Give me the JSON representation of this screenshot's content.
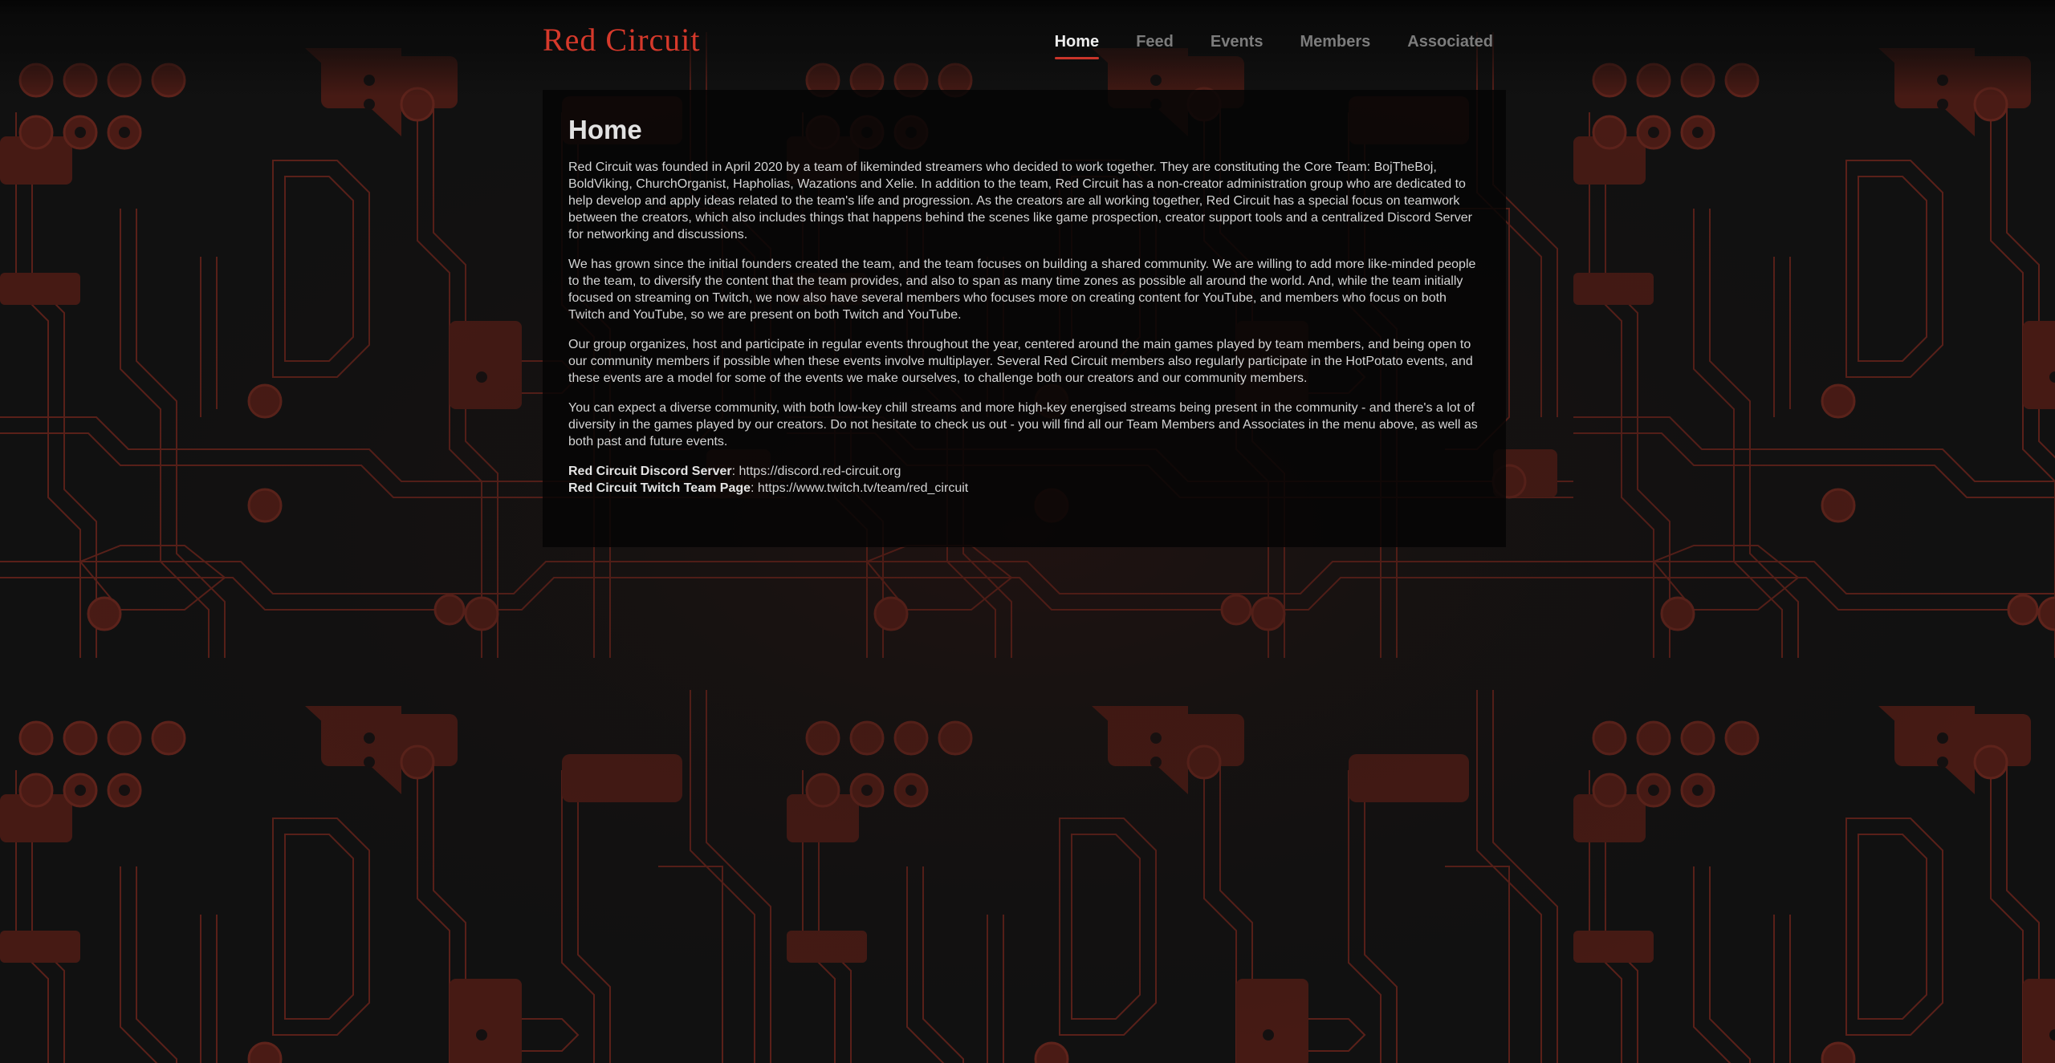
{
  "site": {
    "logo_text": "Red Circuit",
    "brand_color": "#d6392b",
    "accent_color": "#c9352a"
  },
  "nav": {
    "items": [
      {
        "label": "Home",
        "active": true
      },
      {
        "label": "Feed",
        "active": false
      },
      {
        "label": "Events",
        "active": false
      },
      {
        "label": "Members",
        "active": false
      },
      {
        "label": "Associated",
        "active": false
      }
    ]
  },
  "content": {
    "title": "Home",
    "paragraphs": [
      "Red Circuit was founded in April 2020 by a team of likeminded streamers who decided to work together. They are constituting the Core Team: BojTheBoj, BoldViking, ChurchOrganist, Hapholias, Wazations and Xelie. In addition to the team, Red Circuit has a non-creator administration group who are dedicated to help develop and apply ideas related to the team's life and progression. As the creators are all working together, Red Circuit has a special focus on teamwork between the creators, which also includes things that happens behind the scenes like game prospection, creator support tools and a centralized Discord Server for networking and discussions.",
      "We has grown since the initial founders created the team, and the team focuses on building a shared community. We are willing to add more like-minded people to the team, to diversify the content that the team provides, and also to span as many time zones as possible all around the world. And, while the team initially focused on streaming on Twitch, we now also have several members who focuses more on creating content for YouTube, and members who focus on both Twitch and YouTube, so we are present on both Twitch and YouTube.",
      "Our group organizes, host and participate in regular events throughout the year, centered around the main games played by team members, and being open to our community members if possible when these events involve multiplayer. Several Red Circuit members also regularly participate in the HotPotato events, and these events are a model for some of the events we make ourselves, to challenge both our creators and our community members.",
      "You can expect a diverse community, with both low-key chill streams and more high-key energised streams being present in the community - and there's a lot of diversity in the games played by our creators. Do not hesitate to check us out - you will find all our Team Members and Associates in the menu above, as well as both past and future events."
    ],
    "discord_label": "Red Circuit Discord Server",
    "discord_url": "https://discord.red-circuit.org",
    "twitch_label": "Red Circuit Twitch Team Page",
    "twitch_url": "https://www.twitch.tv/team/red_circuit",
    "separator": ": "
  }
}
